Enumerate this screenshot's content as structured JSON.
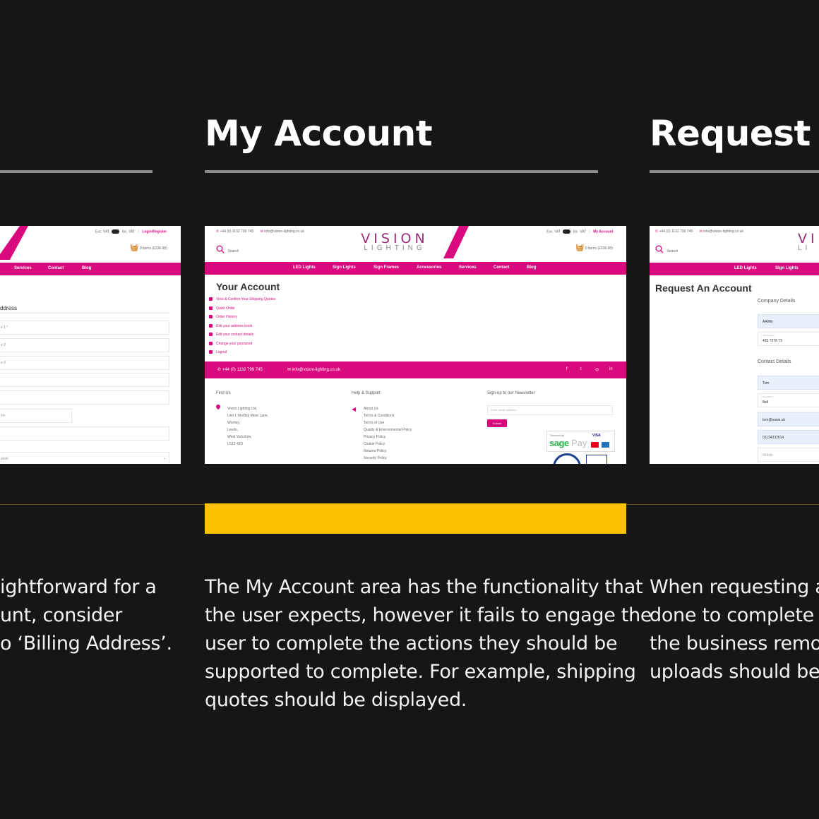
{
  "columns": {
    "left": {
      "paragraph": [
        "ightforward for a",
        "unt, consider",
        "o ‘Billing Address’."
      ],
      "shot": {
        "top_links": [
          "Exc. VAT",
          "Inc. VAT",
          "Login/Register"
        ],
        "basket": "0 items (£236.98)",
        "nav": [
          "Services",
          "Contact",
          "Blog"
        ],
        "section": "ddress",
        "field_labels": [
          "e 1 *",
          "e 2",
          "e 3",
          "",
          "",
          "ble",
          "",
          "stom"
        ]
      }
    },
    "center": {
      "heading": "My Account",
      "paragraph": [
        "The My Account area has the functionality that",
        "the user expects, however it fails to engage the",
        "user to complete the actions they should be",
        "supported to complete. For example, shipping",
        "quotes should be displayed."
      ],
      "shot": {
        "phone_top": "+44 (0) 1132 799 745",
        "email_top": "info@vision-lighting.co.uk",
        "logo_top": "VISION",
        "logo_bottom": "LIGHTING",
        "top_links": [
          "Exc. VAT",
          "Inc. VAT",
          "My Account"
        ],
        "search": "Search",
        "basket": "0 items (£236.98)",
        "nav": [
          "LED Lights",
          "Sign Lights",
          "Sign Frames",
          "Accessories",
          "Services",
          "Contact",
          "Blog"
        ],
        "title": "Your Account",
        "menu": [
          "View & Confirm Your Shipping Quotes",
          "Quick Order",
          "Order History",
          "Edit your address book",
          "Edit your contact details",
          "Change your password",
          "Logout"
        ],
        "footer_phone": "+44 (0) 1132 799 745",
        "footer_email": "info@vision-lighting.co.uk",
        "social": [
          "f",
          "t",
          "◎",
          "in"
        ],
        "find_us": "Find Us",
        "address": [
          "Vision Lighting Ltd,",
          "Unit 1 Wortley Moor Lane,",
          "Wortley,",
          "Leeds,",
          "West Yorkshire,",
          "LS12 4JD"
        ],
        "help": "Help & Support",
        "help_links": [
          "About Us",
          "Terms & Conditions",
          "Terms of Use",
          "Quality & Environmental Policy",
          "Privacy Policy",
          "Cookie Policy",
          "Returns Policy",
          "Security Policy"
        ],
        "newsletter": "Sign-up to our Newsletter",
        "newsletter_placeholder": "Enter email address...",
        "submit": "Submit",
        "secured_by": "Secured by",
        "sage": "sage",
        "pay": "Pay",
        "visa": "VISA"
      }
    },
    "right": {
      "heading": "Request A",
      "paragraph": [
        "When requesting a t",
        "done to complete th",
        "the business remote",
        "uploads should be s"
      ],
      "shot": {
        "phone_top": "+44 (0) 1132 799 745",
        "email_top": "info@vision-lighting.co.uk",
        "logo_top": "VI",
        "logo_bottom": "LI",
        "search": "Search",
        "nav": [
          "LED Lights",
          "Sign Lights"
        ],
        "title": "Request An Account",
        "company_details": "Company Details",
        "company_value": "AAWE",
        "vat_label": "VAT Number",
        "vat_value": "435 7278 73",
        "contact_details": "Contact Details",
        "first_name": "Tom",
        "last_name_label": "Last Name *",
        "last_name": "Bell",
        "email": "tom@aawe.uk",
        "phone": "01134332614",
        "mobile": "Mobile"
      }
    }
  },
  "colors": {
    "background": "#161517",
    "brand_pink": "#d9097e",
    "accent_yellow": "#fdc100",
    "rule_gray": "#8b8b8e"
  }
}
